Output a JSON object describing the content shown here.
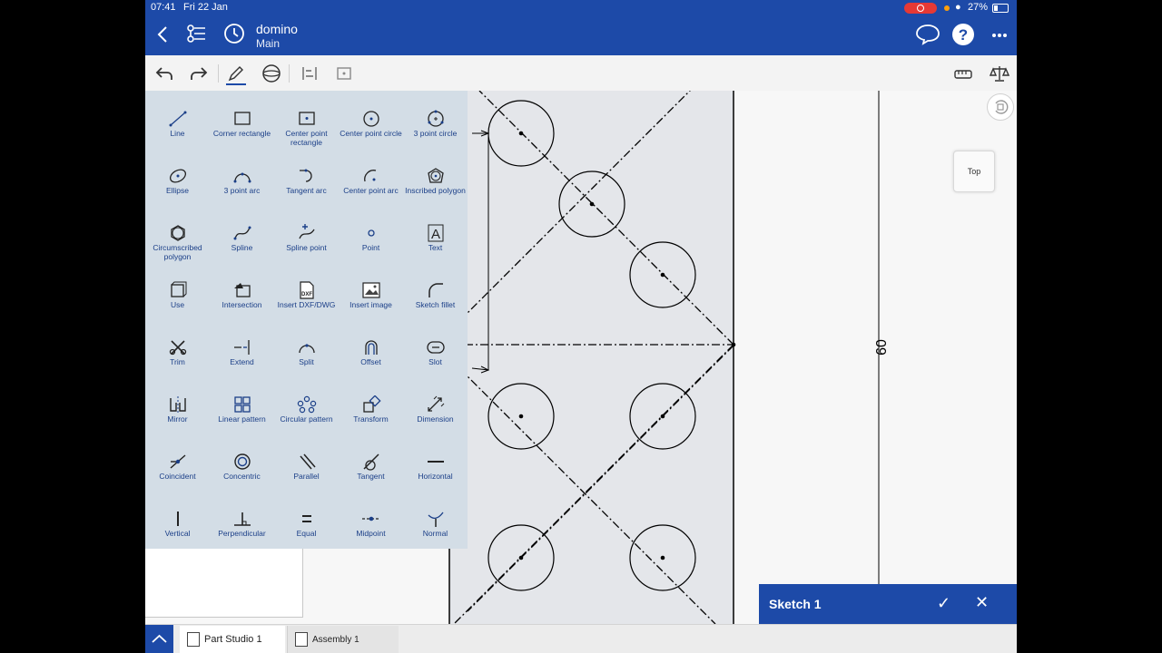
{
  "status": {
    "time": "07:41",
    "date": "Fri 22 Jan",
    "battery": "27%"
  },
  "header": {
    "title": "domino",
    "branch": "Main"
  },
  "view_cube": {
    "label": "Top"
  },
  "drawing": {
    "dimension": "60"
  },
  "tools": [
    {
      "name": "line",
      "label": "Line"
    },
    {
      "name": "corner-rectangle",
      "label": "Corner rectangle"
    },
    {
      "name": "center-point-rectangle",
      "label": "Center point rectangle"
    },
    {
      "name": "center-point-circle",
      "label": "Center point circle"
    },
    {
      "name": "3-point-circle",
      "label": "3 point circle"
    },
    {
      "name": "ellipse",
      "label": "Ellipse"
    },
    {
      "name": "3-point-arc",
      "label": "3 point arc"
    },
    {
      "name": "tangent-arc",
      "label": "Tangent arc"
    },
    {
      "name": "center-point-arc",
      "label": "Center point arc"
    },
    {
      "name": "inscribed-polygon",
      "label": "Inscribed polygon"
    },
    {
      "name": "circumscribed-polygon",
      "label": "Circumscribed polygon"
    },
    {
      "name": "spline",
      "label": "Spline"
    },
    {
      "name": "spline-point",
      "label": "Spline point"
    },
    {
      "name": "point",
      "label": "Point"
    },
    {
      "name": "text",
      "label": "Text"
    },
    {
      "name": "use",
      "label": "Use"
    },
    {
      "name": "intersection",
      "label": "Intersection"
    },
    {
      "name": "insert-dxf-dwg",
      "label": "Insert DXF/DWG"
    },
    {
      "name": "insert-image",
      "label": "Insert image"
    },
    {
      "name": "sketch-fillet",
      "label": "Sketch fillet"
    },
    {
      "name": "trim",
      "label": "Trim"
    },
    {
      "name": "extend",
      "label": "Extend"
    },
    {
      "name": "split",
      "label": "Split"
    },
    {
      "name": "offset",
      "label": "Offset"
    },
    {
      "name": "slot",
      "label": "Slot"
    },
    {
      "name": "mirror",
      "label": "Mirror"
    },
    {
      "name": "linear-pattern",
      "label": "Linear pattern"
    },
    {
      "name": "circular-pattern",
      "label": "Circular pattern"
    },
    {
      "name": "transform",
      "label": "Transform"
    },
    {
      "name": "dimension",
      "label": "Dimension"
    },
    {
      "name": "coincident",
      "label": "Coincident"
    },
    {
      "name": "concentric",
      "label": "Concentric"
    },
    {
      "name": "parallel",
      "label": "Parallel"
    },
    {
      "name": "tangent",
      "label": "Tangent"
    },
    {
      "name": "horizontal",
      "label": "Horizontal"
    },
    {
      "name": "vertical",
      "label": "Vertical"
    },
    {
      "name": "perpendicular",
      "label": "Perpendicular"
    },
    {
      "name": "equal",
      "label": "Equal"
    },
    {
      "name": "midpoint",
      "label": "Midpoint"
    },
    {
      "name": "normal",
      "label": "Normal"
    }
  ],
  "sketch": {
    "name": "Sketch 1"
  },
  "tabs": [
    {
      "label": "Part Studio 1"
    },
    {
      "label": "Assembly 1"
    }
  ],
  "colors": {
    "brand": "#1d4aa8",
    "panel": "#d3dde6",
    "tool_label": "#1b3f88"
  }
}
